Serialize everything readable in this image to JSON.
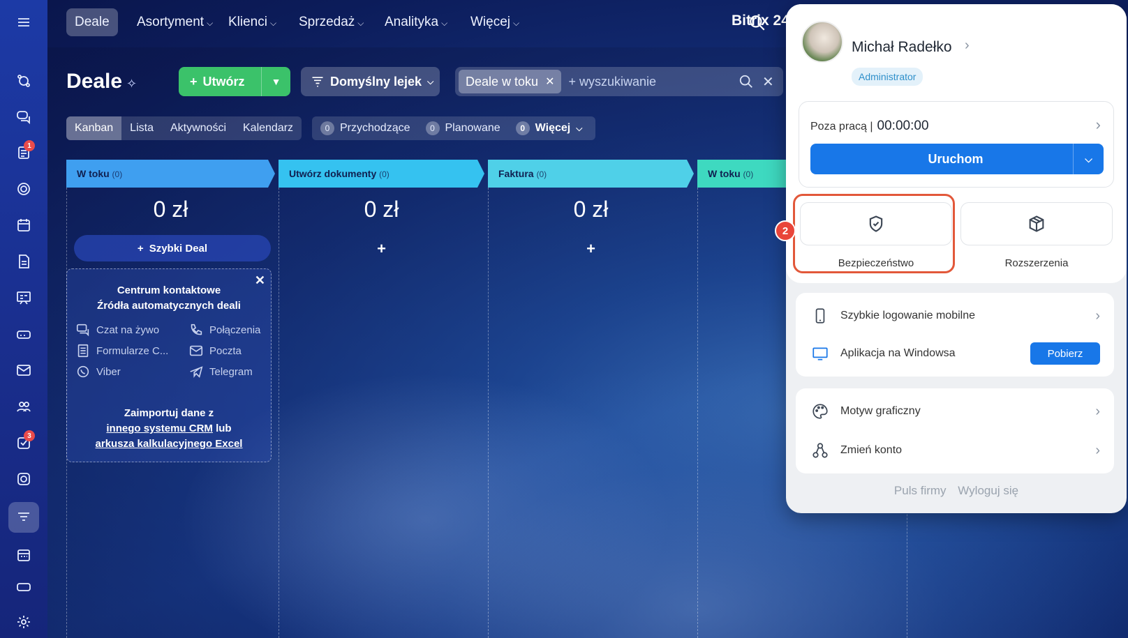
{
  "nav": {
    "items": [
      {
        "label": "Deale",
        "active": true,
        "chevron": false
      },
      {
        "label": "Asortyment",
        "chevron": true
      },
      {
        "label": "Klienci",
        "chevron": true
      },
      {
        "label": "Sprzedaż",
        "chevron": true
      },
      {
        "label": "Analityka",
        "chevron": true
      },
      {
        "label": "Więcej",
        "chevron": true
      }
    ],
    "brand": "Bitrix 24"
  },
  "sidebar": {
    "badges": {
      "feed": "1",
      "tasks": "3"
    }
  },
  "header": {
    "title": "Deale",
    "create_label": "Utwórz",
    "funnel_label": "Domyślny lejek",
    "filter_chip": "Deale w toku",
    "search_placeholder": "+ wyszukiwanie"
  },
  "view_tabs": [
    "Kanban",
    "Lista",
    "Aktywności",
    "Kalendarz"
  ],
  "counters": [
    {
      "num": "0",
      "label": "Przychodzące"
    },
    {
      "num": "0",
      "label": "Planowane"
    },
    {
      "num": "0",
      "label": "Więcej"
    }
  ],
  "columns": [
    {
      "title": "W toku",
      "count": "(0)",
      "sum": "0 zł",
      "color": "#3f9ff0"
    },
    {
      "title": "Utwórz dokumenty",
      "count": "(0)",
      "sum": "0 zł",
      "color": "#35c2f0"
    },
    {
      "title": "Faktura",
      "count": "(0)",
      "sum": "0 zł",
      "color": "#4fd0e8"
    },
    {
      "title": "W toku",
      "count": "(0)",
      "sum": "",
      "color": "#3ed9c0"
    }
  ],
  "quick_deal": "Szybki Deal",
  "contact_center": {
    "title_line1": "Centrum kontaktowe",
    "title_line2": "Źródła automatycznych deali",
    "sources": [
      "Czat na żywo",
      "Połączenia",
      "Formularze C...",
      "Poczta",
      "Viber",
      "Telegram"
    ],
    "import_line1": "Zaimportuj dane z",
    "import_link1": "innego systemu CRM",
    "import_or": " lub",
    "import_link2": "arkusza kalkulacyjnego Excel"
  },
  "profile": {
    "name": "Michał Radełko",
    "role": "Administrator",
    "status_label": "Poza pracą |",
    "timer": "00:00:00",
    "start_label": "Uruchom",
    "tiles": [
      "Bezpieczeństwo",
      "Rozszerzenia"
    ],
    "step_number": "2",
    "apps": [
      {
        "label": "Szybkie logowanie mobilne"
      },
      {
        "label": "Aplikacja na Windowsa",
        "button": "Pobierz"
      }
    ],
    "settings": [
      "Motyw graficzny",
      "Zmień konto"
    ],
    "footer": [
      "Puls firmy",
      "Wyloguj się"
    ]
  }
}
